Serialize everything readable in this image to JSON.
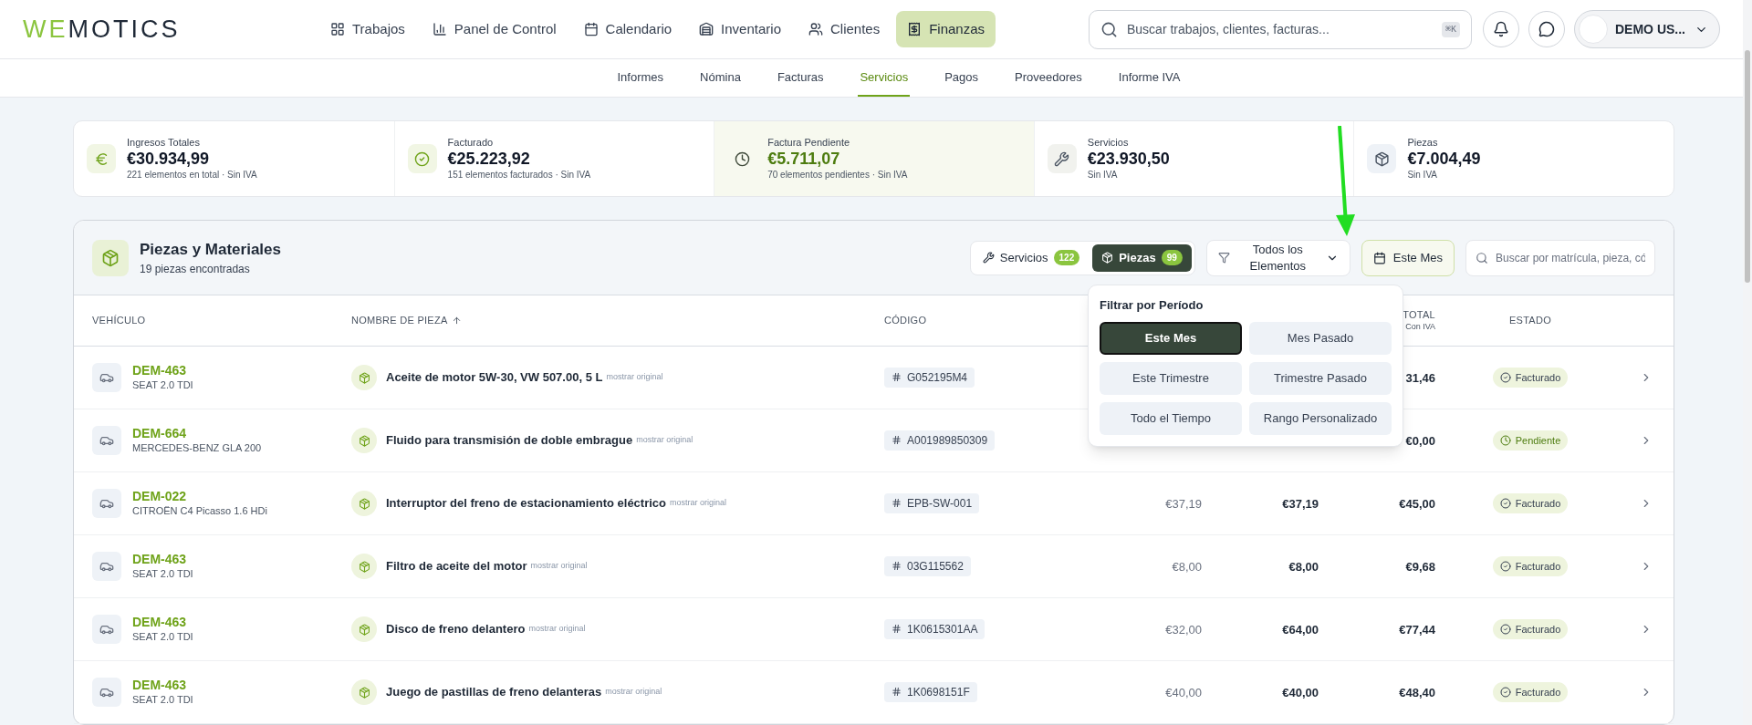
{
  "logo": {
    "accent": "WE",
    "rest": "MOTICS"
  },
  "nav": [
    {
      "label": "Trabajos",
      "selected": false
    },
    {
      "label": "Panel de Control",
      "selected": false
    },
    {
      "label": "Calendario",
      "selected": false
    },
    {
      "label": "Inventario",
      "selected": false
    },
    {
      "label": "Clientes",
      "selected": false
    },
    {
      "label": "Finanzas",
      "selected": true
    }
  ],
  "search": {
    "placeholder": "Buscar trabajos, clientes, facturas...",
    "shortcut": "⌘K"
  },
  "user": {
    "name": "DEMO US..."
  },
  "subnav": [
    {
      "label": "Informes",
      "selected": false
    },
    {
      "label": "Nómina",
      "selected": false
    },
    {
      "label": "Facturas",
      "selected": false
    },
    {
      "label": "Servicios",
      "selected": true
    },
    {
      "label": "Pagos",
      "selected": false
    },
    {
      "label": "Proveedores",
      "selected": false
    },
    {
      "label": "Informe IVA",
      "selected": false
    }
  ],
  "stats": [
    {
      "label": "Ingresos Totales",
      "value": "€30.934,99",
      "sub": "221 elementos en total · Sin IVA",
      "selected": false
    },
    {
      "label": "Facturado",
      "value": "€25.223,92",
      "sub": "151 elementos facturados · Sin IVA",
      "selected": false
    },
    {
      "label": "Factura Pendiente",
      "value": "€5.711,07",
      "sub": "70 elementos pendientes · Sin IVA",
      "selected": true
    },
    {
      "label": "Servicios",
      "value": "€23.930,50",
      "sub": "Sin IVA",
      "selected": false
    },
    {
      "label": "Piezas",
      "value": "€7.004,49",
      "sub": "Sin IVA",
      "selected": false
    }
  ],
  "panel": {
    "title": "Piezas y Materiales",
    "subtitle": "19 piezas encontradas",
    "toggle": [
      {
        "label": "Servicios",
        "count": "122",
        "selected": false
      },
      {
        "label": "Piezas",
        "count": "99",
        "selected": true
      }
    ],
    "filter": "Todos los Elementos",
    "period": "Este Mes",
    "search_placeholder": "Buscar por matrícula, pieza, có"
  },
  "period_menu": {
    "title": "Filtrar por Período",
    "options": [
      {
        "label": "Este Mes",
        "selected": true
      },
      {
        "label": "Mes Pasado",
        "selected": false
      },
      {
        "label": "Este Trimestre",
        "selected": false
      },
      {
        "label": "Trimestre Pasado",
        "selected": false
      },
      {
        "label": "Todo el Tiempo",
        "selected": false
      },
      {
        "label": "Rango Personalizado",
        "selected": false
      }
    ]
  },
  "table": {
    "columns": [
      {
        "label": "VEHÍCULO"
      },
      {
        "label": "NOMBRE DE PIEZA",
        "sorted": true
      },
      {
        "label": "CÓDIGO"
      },
      {},
      {},
      {
        "label": "TOTAL",
        "sub": "Con IVA"
      },
      {
        "label": "ESTADO"
      }
    ],
    "rows": [
      {
        "plate": "DEM-463",
        "model": "SEAT 2.0 TDI",
        "name": "Aceite de motor 5W-30, VW 507.00, 5 L",
        "link": "mostrar original",
        "code": "G052195M4",
        "total": "31,46",
        "status": "Facturado",
        "kind": "invoiced"
      },
      {
        "plate": "DEM-664",
        "model": "MERCEDES-BENZ GLA 200",
        "name": "Fluido para transmisión de doble embrague",
        "link": "mostrar original",
        "code": "A001989850309",
        "total": "€0,00",
        "status": "Pendiente",
        "kind": "pending"
      },
      {
        "plate": "DEM-022",
        "model": "CITROËN C4 Picasso 1.6 HDi",
        "name": "Interruptor del freno de estacionamiento eléctrico",
        "link": "mostrar original",
        "code": "EPB-SW-001",
        "column_4": "€37,19",
        "column_5": "€37,19",
        "total": "€45,00",
        "status": "Facturado",
        "kind": "invoiced"
      },
      {
        "plate": "DEM-463",
        "model": "SEAT 2.0 TDI",
        "name": "Filtro de aceite del motor",
        "link": "mostrar original",
        "code": "03G115562",
        "column_4": "€8,00",
        "column_5": "€8,00",
        "total": "€9,68",
        "status": "Facturado",
        "kind": "invoiced"
      },
      {
        "plate": "DEM-463",
        "model": "SEAT 2.0 TDI",
        "name": "Disco de freno delantero",
        "link": "mostrar original",
        "code": "1K0615301AA",
        "column_4": "€32,00",
        "column_5": "€64,00",
        "total": "€77,44",
        "status": "Facturado",
        "kind": "invoiced"
      },
      {
        "plate": "DEM-463",
        "model": "SEAT 2.0 TDI",
        "name": "Juego de pastillas de freno delanteras",
        "link": "mostrar original",
        "code": "1K0698151F",
        "column_4": "€40,00",
        "column_5": "€40,00",
        "total": "€48,40",
        "status": "Facturado",
        "kind": "invoiced"
      }
    ]
  }
}
